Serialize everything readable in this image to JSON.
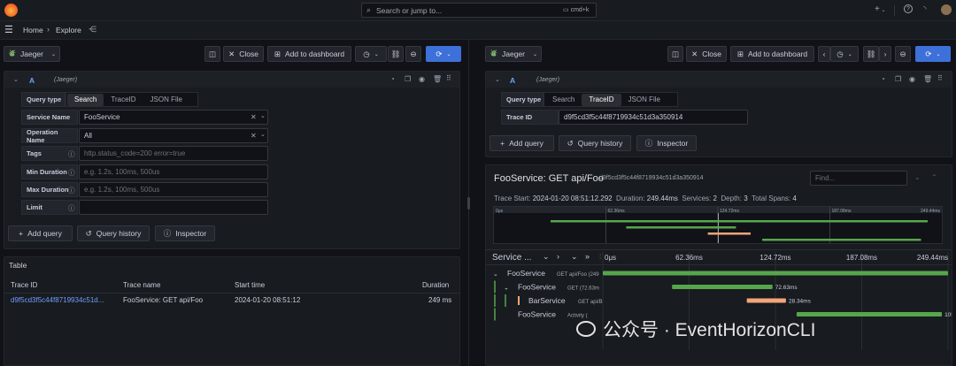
{
  "topbar": {
    "search_placeholder": "Search or jump to...",
    "shortcut": "cmd+k",
    "plus": "+"
  },
  "breadcrumb": {
    "home": "Home",
    "sep": "›",
    "current": "Explore"
  },
  "left": {
    "datasource": "Jaeger",
    "close": "Close",
    "add_to_dashboard": "Add to dashboard",
    "query_letter": "A",
    "query_ds": "(Jaeger)",
    "query_type_label": "Query type",
    "tabs": [
      "Search",
      "TraceID",
      "JSON File"
    ],
    "service_name_label": "Service Name",
    "service_name_value": "FooService",
    "operation_name_label": "Operation Name",
    "operation_name_value": "All",
    "tags_label": "Tags",
    "tags_placeholder": "http.status_code=200 error=true",
    "min_duration_label": "Min Duration",
    "min_duration_placeholder": "e.g. 1.2s, 100ms, 500us",
    "max_duration_label": "Max Duration",
    "max_duration_placeholder": "e.g. 1.2s, 100ms, 500us",
    "limit_label": "Limit",
    "add_query": "Add query",
    "query_history": "Query history",
    "inspector": "Inspector",
    "table_title": "Table",
    "columns": [
      "Trace ID",
      "Trace name",
      "Start time",
      "Duration"
    ],
    "rows": [
      {
        "trace_id": "d9f5cd3f5c44f8719934c51d...",
        "trace_name": "FooService: GET api/Foo",
        "start": "2024-01-20 08:51:12",
        "duration": "249 ms"
      }
    ]
  },
  "right": {
    "datasource": "Jaeger",
    "close": "Close",
    "add_to_dashboard": "Add to dashboard",
    "query_letter": "A",
    "query_ds": "(Jaeger)",
    "query_type_label": "Query type",
    "tabs": [
      "Search",
      "TraceID",
      "JSON File"
    ],
    "trace_id_label": "Trace ID",
    "trace_id_value": "d9f5cd3f5c44f8719934c51d3a350914",
    "add_query": "Add query",
    "query_history": "Query history",
    "inspector": "Inspector",
    "trace": {
      "title": "FooService: GET api/Foo",
      "id": "d9f5cd3f5c44f8719934c51d3a350914",
      "find_placeholder": "Find...",
      "trace_start_label": "Trace Start:",
      "trace_start": "2024-01-20 08:51:12.292",
      "duration_label": "Duration:",
      "duration": "249.44ms",
      "services_label": "Services:",
      "services": "2",
      "depth_label": "Depth:",
      "depth": "3",
      "total_spans_label": "Total Spans:",
      "total_spans": "4",
      "minimap_ticks": [
        "0μs",
        "62.36ms",
        "124.72ms",
        "187.08ms",
        "249.44ms"
      ],
      "service_header": "Service ...",
      "timeline_ticks": [
        "0μs",
        "62.36ms",
        "124.72ms",
        "187.08ms",
        "249.44ms"
      ],
      "spans": [
        {
          "service": "FooService",
          "op": "GET api/Foo (249",
          "label": "",
          "start": 0,
          "dur": 249.44,
          "color": "#56a64b",
          "indent": 0,
          "toggle": "⌄"
        },
        {
          "service": "FooService",
          "op": "GET (72.63m",
          "label": "72.63ms",
          "start": 50,
          "dur": 72.63,
          "color": "#56a64b",
          "indent": 1,
          "toggle": "⌄"
        },
        {
          "service": "BarService",
          "op": "GET api/B",
          "label": "28.34ms",
          "start": 104,
          "dur": 28.34,
          "color": "#f2a578",
          "indent": 2,
          "toggle": ""
        },
        {
          "service": "FooService",
          "op": "Activity (",
          "label": "105.01ms",
          "start": 140,
          "dur": 105.01,
          "color": "#56a64b",
          "indent": 1,
          "toggle": ""
        }
      ]
    }
  },
  "watermark": "公众号 · EventHorizonCLI"
}
